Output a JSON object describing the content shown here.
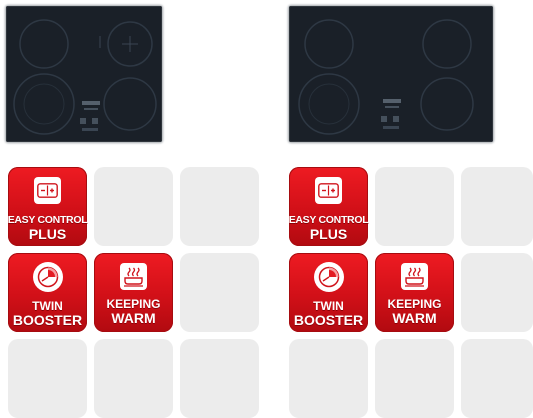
{
  "panels": [
    {
      "features": [
        {
          "line1": "EASY CONTROL",
          "line2": "PLUS",
          "icon": "easy-control-icon"
        },
        {
          "line1": "TWIN",
          "line2": "BOOSTER",
          "icon": "twin-booster-icon"
        },
        {
          "line1": "KEEPING",
          "line2": "WARM",
          "icon": "keeping-warm-icon"
        }
      ]
    },
    {
      "features": [
        {
          "line1": "EASY CONTROL",
          "line2": "PLUS",
          "icon": "easy-control-icon"
        },
        {
          "line1": "TWIN",
          "line2": "BOOSTER",
          "icon": "twin-booster-icon"
        },
        {
          "line1": "KEEPING",
          "line2": "WARM",
          "icon": "keeping-warm-icon"
        }
      ]
    }
  ],
  "colors": {
    "badge_red": "#e31b23",
    "empty_tile": "#ececec",
    "cooktop_glass": "#1a2028"
  }
}
